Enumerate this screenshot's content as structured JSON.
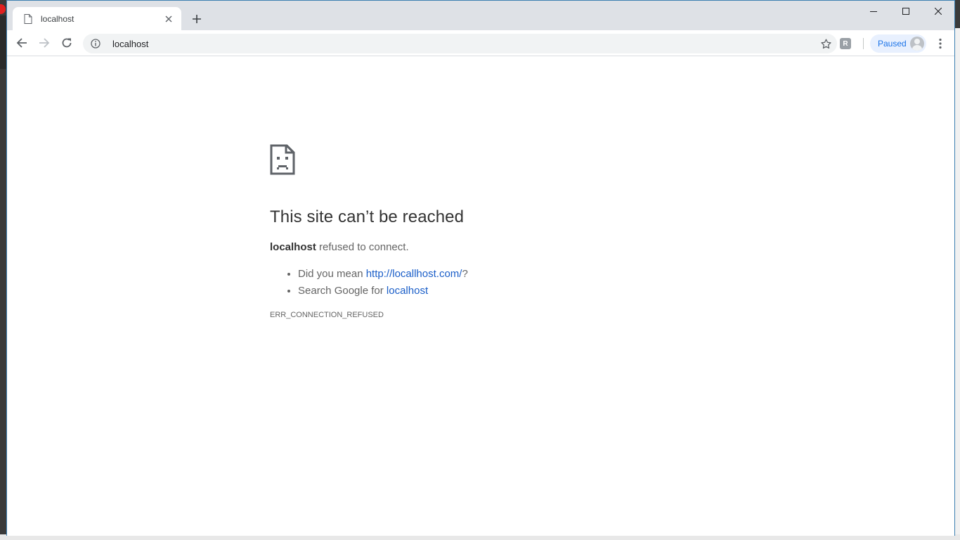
{
  "browser": {
    "tab": {
      "title": "localhost",
      "icon": "document-icon",
      "close_icon": "close-icon"
    },
    "new_tab_icon": "plus-icon",
    "window_controls": [
      "minimize-icon",
      "maximize-icon",
      "close-icon"
    ],
    "address_bar": {
      "url": "localhost",
      "icon": "info-icon"
    },
    "profile": {
      "label": "Paused"
    },
    "colors": {
      "titlebar": "#dee1e6",
      "accent": "#1a73e8",
      "link": "#1a5ec8"
    }
  },
  "error_page": {
    "icon": "sad-page-icon",
    "title": "This site can’t be reached",
    "summary": {
      "host": "localhost",
      "message": " refused to connect."
    },
    "suggestions": [
      {
        "prefix": "Did you mean ",
        "link": "http://locallhost.com/",
        "suffix": "?"
      },
      {
        "prefix": "Search Google for ",
        "link": "localhost",
        "suffix": ""
      }
    ],
    "error_code": "ERR_CONNECTION_REFUSED"
  }
}
